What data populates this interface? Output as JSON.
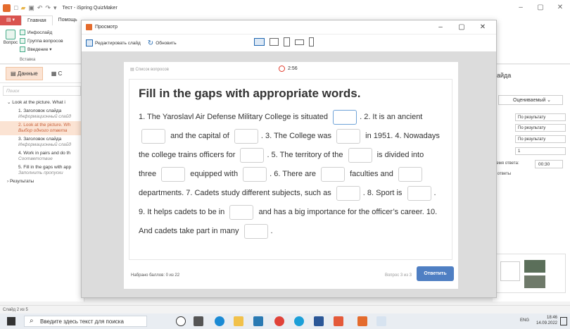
{
  "app": {
    "title": "Тест - iSpring QuizMaker"
  },
  "ribbon": {
    "tabs": [
      "Главная",
      "Помощь"
    ],
    "question_label": "Вопрос",
    "items": [
      "Инфослайд",
      "Группа вопросов",
      "Введение ▾"
    ],
    "group_label": "Вставка"
  },
  "left_panel": {
    "tabs": [
      "Данные",
      "С"
    ],
    "search_placeholder": "Поиск",
    "tree": [
      {
        "title": "Look at the picture. What i",
        "sub": ""
      },
      {
        "title": "1. Заголовок слайда",
        "sub": "Информационный слайд"
      },
      {
        "title": "2. Look at the picture. Wh",
        "sub": "Выбор одного ответа"
      },
      {
        "title": "3. Заголовок слайда",
        "sub": "Информационный слайд"
      },
      {
        "title": "4. Work in pairs and do th",
        "sub": "Соответствие"
      },
      {
        "title": "5. Fill in the gaps with app",
        "sub": "Заполнить пропуски"
      },
      {
        "title": "Результаты",
        "sub": ""
      }
    ]
  },
  "right_panel": {
    "title": "айда",
    "grading_button": "Оцениваемый",
    "selects": [
      "По результату",
      "По результату",
      "По результату",
      "1"
    ],
    "time_label": "ремя ответа:",
    "time_value": "00:30",
    "answers_label": "ь ответы"
  },
  "preview": {
    "title": "Просмотр",
    "edit_slide": "Редактировать слайд",
    "refresh": "Обновить",
    "question_list": "Список вопросов",
    "timer": "2:56",
    "question_title": "Fill in the gaps with appropriate words.",
    "text_segments": [
      "1. The Yaroslavl Air Defense Military College is situated",
      ". 2. It is an ancient",
      "and the capital of",
      ". 3. The College was",
      "in 1951. 4. Nowadays the college trains officers for",
      ". 5. The territory of the",
      "is divided into three",
      "equipped with",
      ". 6. There are",
      "faculties and",
      "departments. 7. Cadets study different subjects, such as",
      ". 8. Sport is",
      ". 9. It helps cadets to be in",
      "and has a big importance for the officer’s career. 10. And cadets take part in many",
      "."
    ],
    "score": "Набрано баллов: 0 из 22",
    "question_number": "Вопрос 3 из 3",
    "submit": "Ответить"
  },
  "status": {
    "slide": "Слайд 2 из 5"
  },
  "taskbar": {
    "search": "Введите здесь текст для поиска",
    "lang": "ENG",
    "time": "18:46",
    "date": "14.09.2022"
  }
}
